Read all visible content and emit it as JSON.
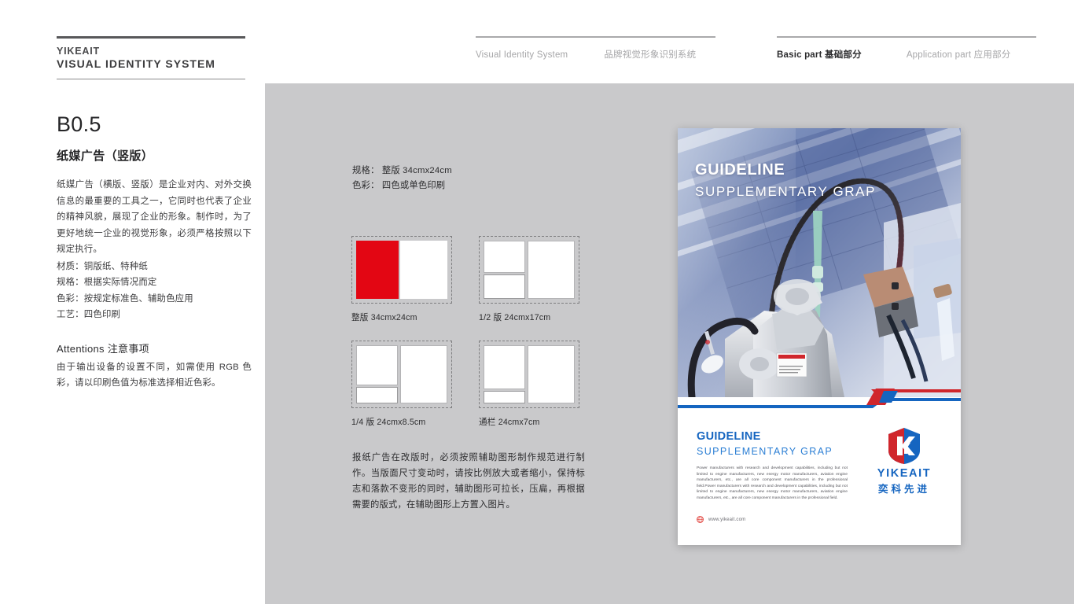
{
  "header": {
    "brand_line1": "YIKEAIT",
    "brand_line2": "VISUAL IDENTITY SYSTEM",
    "nav_left": [
      {
        "label": "Visual Identity System",
        "active": false
      },
      {
        "label": "品牌视觉形象识别系统",
        "active": false
      }
    ],
    "nav_right": [
      {
        "label": "Basic part 基础部分",
        "active": true
      },
      {
        "label": "Application part 应用部分",
        "active": false
      }
    ]
  },
  "sidebar": {
    "doc_code": "B0.5",
    "doc_title": "纸媒广告（竖版）",
    "body": "纸媒广告（横版、竖版）是企业对内、对外交换信息的最重要的工具之一，它同时也代表了企业的精神风貌，展现了企业的形象。制作时，为了更好地统一企业的视觉形象，必须严格按照以下规定执行。",
    "specs": [
      "材质：铜版纸、特种纸",
      "规格：根据实际情况而定",
      "色彩：按规定标准色、辅助色应用",
      "工艺：四色印刷"
    ],
    "attentions_title": "Attentions 注意事项",
    "attentions_body": "由于输出设备的设置不同，如需使用 RGB 色彩，请以印刷色值为标准选择相近色彩。"
  },
  "main": {
    "spec_lines": [
      "规格： 整版 34cmx24cm",
      "色彩： 四色或单色印刷"
    ],
    "layouts": [
      {
        "caption": "整版 34cmx24cm",
        "variant": "a"
      },
      {
        "caption": "1/2 版 24cmx17cm",
        "variant": "b"
      },
      {
        "caption": "1/4 版 24cmx8.5cm",
        "variant": "c"
      },
      {
        "caption": "通栏 24cmx7cm",
        "variant": "d"
      }
    ],
    "notes": "报纸广告在改版时，必须按照辅助图形制作规范进行制作。当版面尺寸变动时，请按比例放大或者缩小，保持标志和落款不变形的同时，辅助图形可拉长，压扁，再根据需要的版式，在辅助图形上方置入图片。"
  },
  "poster": {
    "photo_heading_1": "GUIDELINE",
    "photo_heading_2": "SUPPLEMENTARY GRAP",
    "body_title": "GUIDELINE",
    "body_subtitle": "SUPPLEMENTARY GRAP",
    "body_text": "Power manufacturers with research and development capabilities, including but not limited to engine manufacturers, new energy motor manufacturers, aviation engine manufacturers, etc., are all core component manufacturers in the professional field.Power manufacturers with research and development capabilities, including but not limited to engine manufacturers, new energy motor manufacturers, aviation engine manufacturers, etc., are all core component manufacturers in the professional field.",
    "logo_en": "YIKEAIT",
    "logo_cn": "奕科先进",
    "footer_url": "www.yikeait.com"
  },
  "colors": {
    "canvas_gray": "#c9c9cb",
    "brand_red": "#e30613",
    "brand_blue": "#1565c0",
    "accent_blue": "#2a7ed4",
    "text_dark": "#252527"
  }
}
